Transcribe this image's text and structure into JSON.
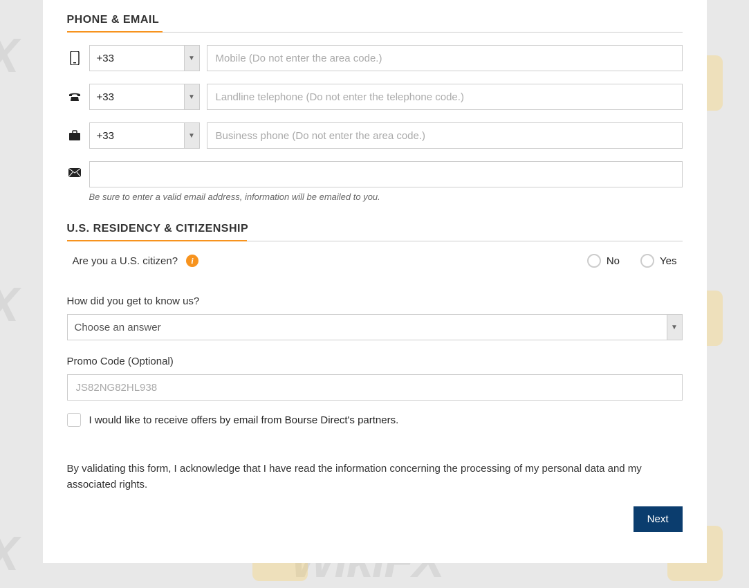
{
  "sections": {
    "phone_email": {
      "title": "PHONE & EMAIL",
      "mobile": {
        "country_code": "+33",
        "placeholder": "Mobile (Do not enter the area code.)"
      },
      "landline": {
        "country_code": "+33",
        "placeholder": "Landline telephone (Do not enter the telephone code.)"
      },
      "business": {
        "country_code": "+33",
        "placeholder": "Business phone (Do not enter the area code.)"
      },
      "email_helper": "Be sure to enter a valid email address, information will be emailed to you."
    },
    "us_residency": {
      "title": "U.S. RESIDENCY & CITIZENSHIP",
      "question": "Are you a U.S. citizen?",
      "option_no": "No",
      "option_yes": "Yes"
    },
    "how_know": {
      "label": "How did you get to know us?",
      "placeholder": "Choose an answer"
    },
    "promo": {
      "label": "Promo Code (Optional)",
      "placeholder": "JS82NG82HL938"
    },
    "offers_checkbox": "I would like to receive offers by email from Bourse Direct's partners.",
    "disclaimer": "By validating this form, I acknowledge that I have read the information concerning the processing of my personal data and my associated rights.",
    "next_button": "Next"
  },
  "watermark_text": "WikiFX",
  "watermark_text_partial": "FX"
}
